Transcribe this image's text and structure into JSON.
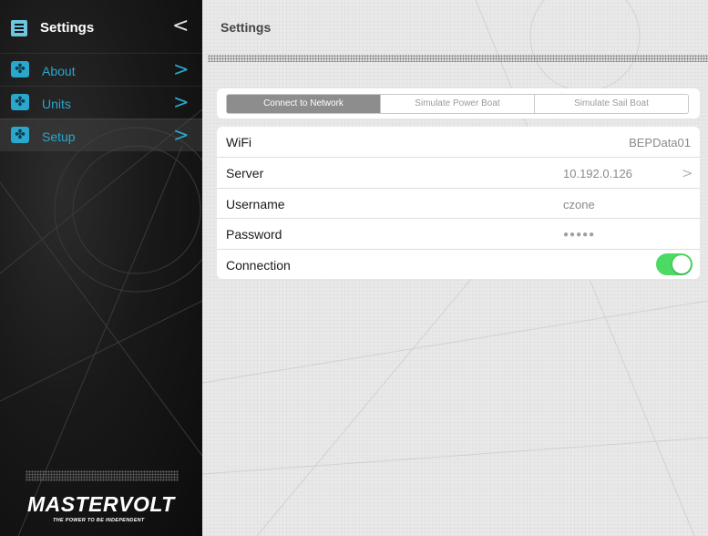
{
  "sidebar": {
    "title": "Settings",
    "collapse_glyph": "<",
    "items": [
      {
        "label": "About",
        "icon": "fan-icon",
        "chevron": ">"
      },
      {
        "label": "Units",
        "icon": "fan-icon",
        "chevron": ">"
      },
      {
        "label": "Setup",
        "icon": "fan-icon",
        "chevron": ">",
        "active": true
      }
    ],
    "logo": "MASTERVOLT",
    "tagline": "THE POWER TO BE INDEPENDENT"
  },
  "main": {
    "title": "Settings",
    "segments": [
      "Connect to Network",
      "Simulate Power Boat",
      "Simulate Sail Boat"
    ],
    "selected_segment": "Connect to Network",
    "rows": [
      {
        "label": "WiFi",
        "value": "BEPData01"
      },
      {
        "label": "Server",
        "value": "10.192.0.126",
        "chevron": ">"
      },
      {
        "label": "Username",
        "value": "czone"
      },
      {
        "label": "Password",
        "value": "●●●●●"
      },
      {
        "label": "Connection",
        "toggle": true
      }
    ]
  },
  "colors": {
    "accent": "#2aa7cc",
    "toggle_on": "#4cd964",
    "segment_selected": "#8d8d8d"
  }
}
